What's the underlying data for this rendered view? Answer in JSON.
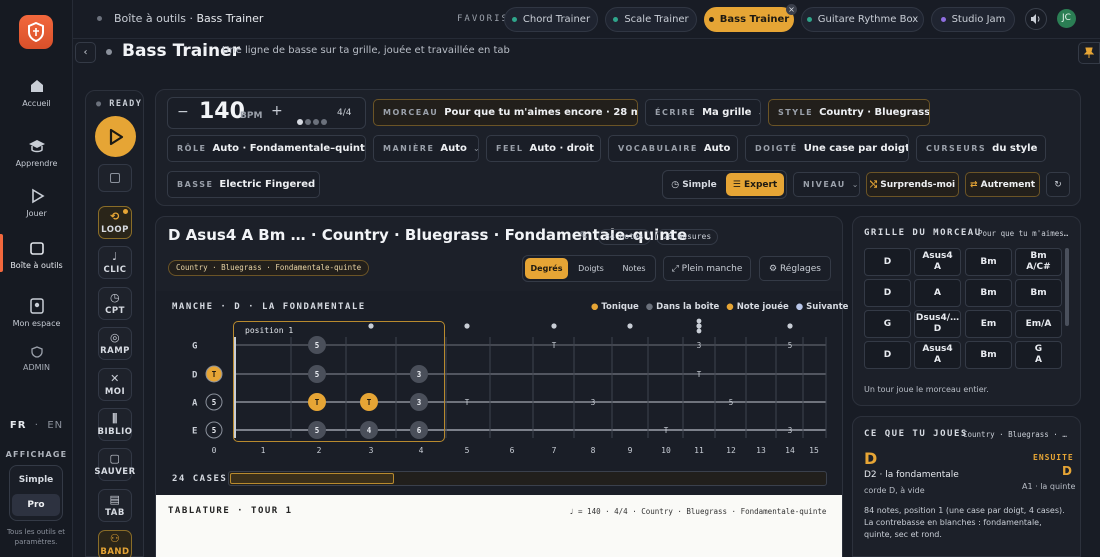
{
  "breadcrumb": {
    "root": "Boîte à outils",
    "sep": "·",
    "page": "Bass Trainer"
  },
  "favoris_label": "FAVORIS",
  "favorites": [
    "Chord Trainer",
    "Scale Trainer",
    "Bass Trainer",
    "Guitare Rythme Box",
    "Studio Jam"
  ],
  "user_initials": "JC",
  "page": {
    "title": "Bass Trainer",
    "subtitle": "Une ligne de basse sur ta grille, jouée et travaillée en tab"
  },
  "sidebar": {
    "items": [
      "Accueil",
      "Apprendre",
      "Jouer",
      "Boîte à outils",
      "Mon espace",
      "ADMIN"
    ],
    "lang_fr": "FR",
    "lang_sep": "·",
    "lang_en": "EN",
    "affichage": "AFFICHAGE",
    "mode_simple": "Simple",
    "mode_pro": "Pro",
    "footnote": "Tous les outils et paramètres."
  },
  "ready": "READY",
  "tempo": {
    "value": "140",
    "unit": "BPM",
    "minus": "−",
    "plus": "+",
    "sig": "4/4"
  },
  "controls": {
    "morceau": {
      "label": "MORCEAU",
      "value": "Pour que tu m'aimes encore · 28 mes."
    },
    "ecrire": {
      "label": "ÉCRIRE",
      "value": "Ma grille"
    },
    "style": {
      "label": "STYLE",
      "value": "Country · Bluegrass"
    },
    "role": {
      "label": "RÔLE",
      "value": "Auto · Fondamentale–quinte"
    },
    "maniere": {
      "label": "MANIÈRE",
      "value": "Auto"
    },
    "feel": {
      "label": "FEEL",
      "value": "Auto · droit"
    },
    "vocab": {
      "label": "VOCABULAIRE",
      "value": "Auto"
    },
    "doigte": {
      "label": "DOIGTÉ",
      "value": "Une case par doigt"
    },
    "curseurs": {
      "label": "CURSEURS",
      "value": "du style"
    },
    "basse": {
      "label": "BASSE",
      "value": "Electric Fingered"
    },
    "simple": "Simple",
    "expert": "Expert",
    "niveau": "NIVEAU",
    "surprends": "Surprends-moi",
    "autrement": "Autrement"
  },
  "tools": [
    "LOOP",
    "CLIC",
    "CPT",
    "RAMP",
    "MOI",
    "BIBLIO",
    "SAUVER",
    "TAB",
    "BAND"
  ],
  "main": {
    "title": "D Asus4 A Bm … · Country · Bluegrass · Fondamentale–quinte",
    "notes_badge": "84 notes",
    "mesures_badge": "28 mesures",
    "tag": "Country · Bluegrass · Fondamentale-quinte",
    "view_tabs": [
      "Degrés",
      "Doigts",
      "Notes"
    ],
    "plein": "Plein manche",
    "reglages": "Réglages",
    "neck_label": "MANCHE · D · LA FONDAMENTALE",
    "legend": [
      "Tonique",
      "Dans la boîte",
      "Note jouée",
      "Suivante"
    ],
    "position": "position 1",
    "strings": [
      "G",
      "D",
      "A",
      "E"
    ],
    "frets": [
      "0",
      "1",
      "2",
      "3",
      "4",
      "5",
      "6",
      "7",
      "8",
      "9",
      "10",
      "11",
      "12",
      "13",
      "14",
      "15"
    ],
    "cases": "24 CASES",
    "tab_label": "TABLATURE · TOUR 1",
    "tab_info": "♩ = 140 · 4/4 · Country · Bluegrass · Fondamentale-quinte"
  },
  "neck_notes": [
    {
      "s": 0,
      "f": 2,
      "t": "5"
    },
    {
      "s": 1,
      "f": 0,
      "t": "T"
    },
    {
      "s": 1,
      "f": 2,
      "t": "5"
    },
    {
      "s": 1,
      "f": 4,
      "t": "3"
    },
    {
      "s": 2,
      "f": 0,
      "t": "5"
    },
    {
      "s": 2,
      "f": 2,
      "t": "T"
    },
    {
      "s": 2,
      "f": 3,
      "t": "T"
    },
    {
      "s": 2,
      "f": 4,
      "t": "3"
    },
    {
      "s": 3,
      "f": 0,
      "t": "5"
    },
    {
      "s": 3,
      "f": 2,
      "t": "5"
    },
    {
      "s": 3,
      "f": 3,
      "t": "4"
    },
    {
      "s": 3,
      "f": 4,
      "t": "6"
    }
  ],
  "far_notes": [
    {
      "s": 0,
      "f": 7,
      "t": "T"
    },
    {
      "s": 0,
      "f": 11,
      "t": "3"
    },
    {
      "s": 0,
      "f": 14,
      "t": "5"
    },
    {
      "s": 1,
      "f": 11,
      "t": "T"
    },
    {
      "s": 2,
      "f": 5,
      "t": "T"
    },
    {
      "s": 2,
      "f": 8,
      "t": "3"
    },
    {
      "s": 2,
      "f": 12,
      "t": "5"
    },
    {
      "s": 3,
      "f": 10,
      "t": "T"
    },
    {
      "s": 3,
      "f": 14,
      "t": "3"
    }
  ],
  "grille": {
    "title": "GRILLE DU MORCEAU",
    "song": "Pour que tu m'aimes…",
    "footer": "Un tour joue le morceau entier.",
    "rows": [
      [
        "D",
        "Asus4\nA",
        "Bm",
        "Bm\nA/C#"
      ],
      [
        "D",
        "A",
        "Bm",
        "Bm"
      ],
      [
        "G",
        "Dsus4/…\nD",
        "Em",
        "Em/A"
      ],
      [
        "D",
        "Asus4\nA",
        "Bm",
        "G\nA"
      ]
    ]
  },
  "current": {
    "title": "CE QUE TU JOUES",
    "tag": "Country · Bluegrass · …",
    "chord": "D",
    "ensuite": "ENSUITE",
    "next": "D",
    "line1": "D2 · la fondamentale",
    "line2": "corde D, à vide",
    "next_note": "A1 · la quinte",
    "desc": "84 notes, position 1 (une case par doigt, 4 cases). La contrebasse en blanches : fondamentale, quinte, sec et rond."
  }
}
